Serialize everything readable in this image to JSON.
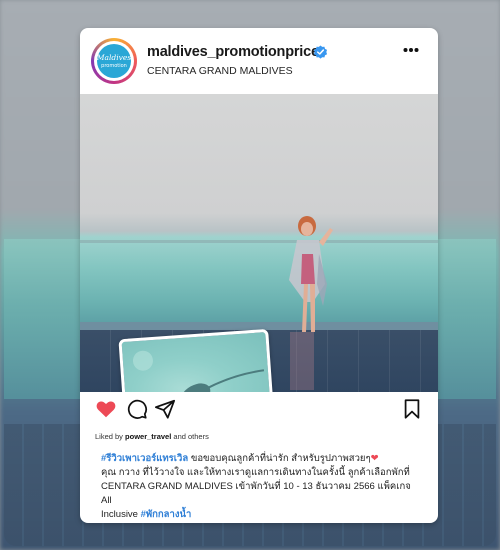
{
  "post": {
    "username": "maldives_promotionprice",
    "location": "CENTARA GRAND MALDIVES",
    "avatar_text": "Maldives promotion",
    "liked_by_prefix": "Liked by ",
    "liked_by_user": "power_travel",
    "liked_by_suffix": " and others",
    "caption": {
      "hashtag1": "#รีวิวเพาเวอร์แทรเวิล",
      "line1_text": " ขอขอบคุณลูกค้าที่น่ารัก สำหรับรูปภาพสวยๆ",
      "heart": "❤",
      "line2": "คุณ กวาง ที่ไว้วางใจ และให้ทางเราดูแลการเดินทางในครั้งนี้ ลูกค้าเลือกพักที่",
      "line3": "CENTARA GRAND MALDIVES เข้าพักวันที่ 10 - 13 ธันวาคม 2566 แพ็คเกจ All",
      "line4_text": "Inclusive ",
      "hashtag2": "#พักกลางน้ำ"
    }
  },
  "icons": {
    "verified": "verified-badge-icon",
    "more": "more-options-icon",
    "like": "heart-icon",
    "comment": "comment-icon",
    "share": "share-icon",
    "save": "bookmark-icon"
  },
  "colors": {
    "like_red": "#ed4956",
    "hashtag_blue": "#2f7fd6",
    "verified_blue": "#3897f0"
  }
}
